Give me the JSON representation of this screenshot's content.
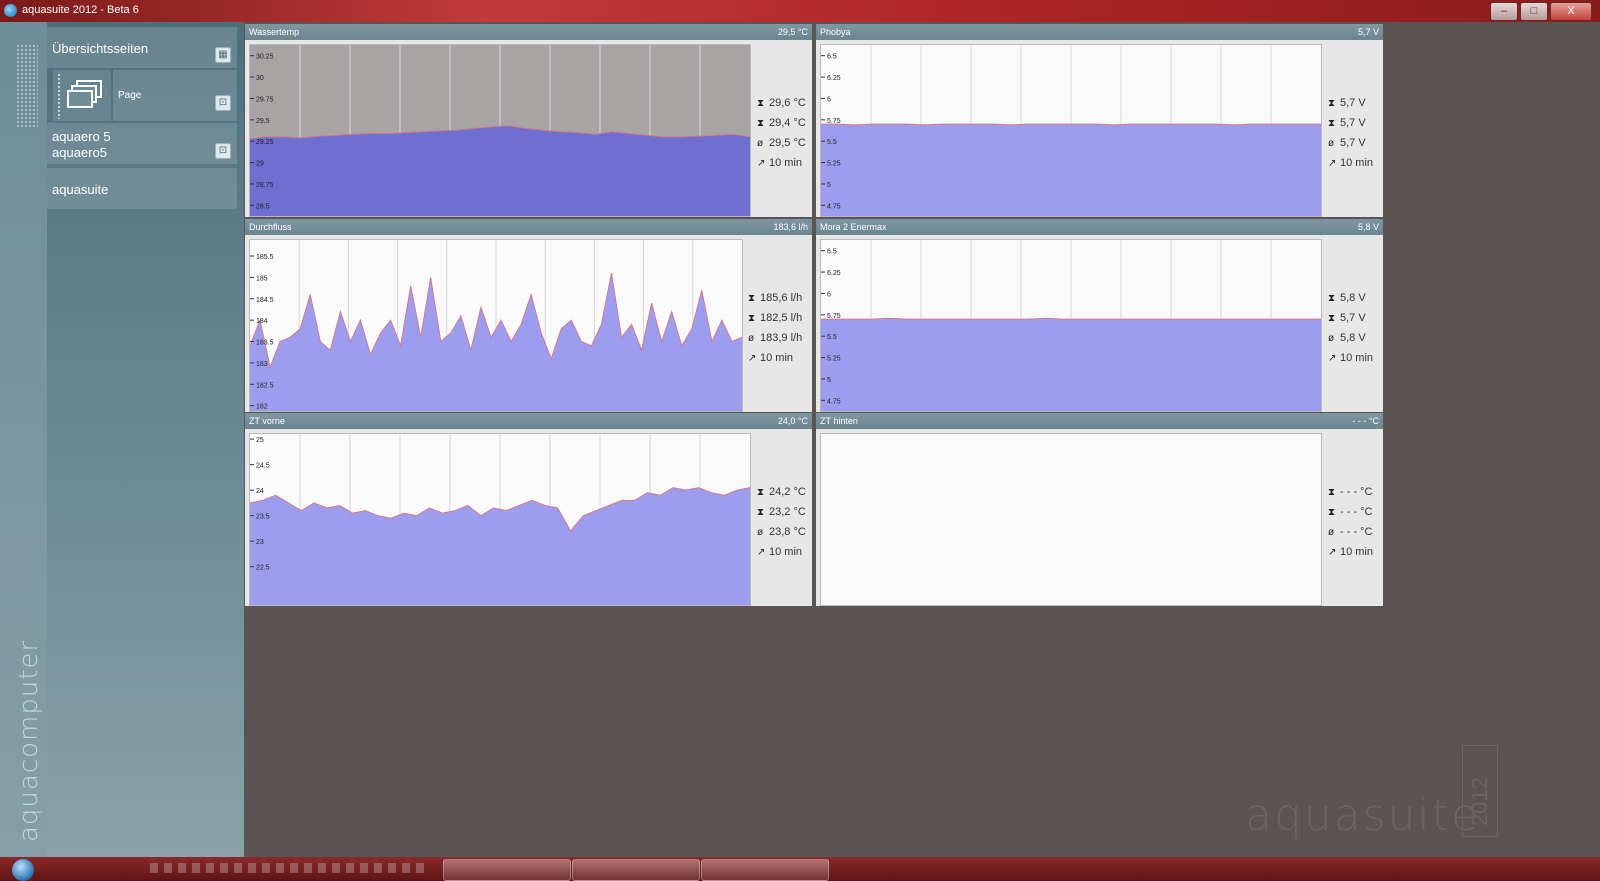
{
  "window": {
    "title": "aquasuite 2012 - Beta 6",
    "controls": {
      "minimize": "–",
      "maximize": "□",
      "close": "X"
    }
  },
  "sidebar": {
    "overview_label": "Übersichtsseiten",
    "page_label": "Page",
    "device_line1": "aquaero 5",
    "device_line2": "aquaero5",
    "aquasuite_label": "aquasuite",
    "brand_vertical": "aquacomputer"
  },
  "panels": {
    "wassertemp": {
      "name": "Wassertemp",
      "value": "29,5 °C",
      "max": "29,6 °C",
      "min": "29,4 °C",
      "avg": "29,5 °C",
      "period": "10 min"
    },
    "phobya": {
      "name": "Phobya",
      "value": "5,7 V",
      "max": "5,7 V",
      "min": "5,7 V",
      "avg": "5,7 V",
      "period": "10 min"
    },
    "durchfluss": {
      "name": "Durchfluss",
      "value": "183,6 l/h",
      "max": "185,6 l/h",
      "min": "182,5 l/h",
      "avg": "183,9 l/h",
      "period": "10 min"
    },
    "mora": {
      "name": "Mora 2 Enermax",
      "value": "5,8 V",
      "max": "5,8 V",
      "min": "5,7 V",
      "avg": "5,8 V",
      "period": "10 min"
    },
    "zt_vorne": {
      "name": "ZT vorne",
      "value": "24,0 °C",
      "max": "24,2 °C",
      "min": "23,2 °C",
      "avg": "23,8 °C",
      "period": "10 min"
    },
    "zt_hinten": {
      "name": "ZT hinten",
      "value": "- - - °C",
      "max": "- - - °C",
      "min": "- - - °C",
      "avg": "- - - °C",
      "period": "10 min"
    }
  },
  "chart_data": [
    {
      "type": "area",
      "id": "wassertemp",
      "yticks": [
        "30.25",
        "30",
        "29.75",
        "29.5",
        "29.25",
        "29",
        "28.75",
        "28.5"
      ],
      "ylim": [
        28.375,
        30.375
      ],
      "values": [
        29.28,
        29.3,
        29.3,
        29.29,
        29.31,
        29.32,
        29.33,
        29.34,
        29.34,
        29.35,
        29.36,
        29.37,
        29.38,
        29.4,
        29.42,
        29.43,
        29.4,
        29.38,
        29.36,
        29.35,
        29.33,
        29.36,
        29.34,
        29.32,
        29.3,
        29.3,
        29.31,
        29.32,
        29.33,
        29.3
      ],
      "fill": "#6b6bd4"
    },
    {
      "type": "area",
      "id": "phobya",
      "yticks": [
        "6.5",
        "6.25",
        "6",
        "5.75",
        "5.5",
        "5.25",
        "5",
        "4.75"
      ],
      "ylim": [
        4.625,
        6.625
      ],
      "values": [
        5.7,
        5.7,
        5.69,
        5.7,
        5.7,
        5.7,
        5.69,
        5.7,
        5.7,
        5.7,
        5.7,
        5.69,
        5.7,
        5.7,
        5.7,
        5.7,
        5.7,
        5.69,
        5.7,
        5.7,
        5.7,
        5.7,
        5.7,
        5.7,
        5.69,
        5.7,
        5.7,
        5.7,
        5.7,
        5.7
      ],
      "fill": "#9898ee"
    },
    {
      "type": "area",
      "id": "durchfluss",
      "yticks": [
        "185.5",
        "185",
        "184.5",
        "184",
        "183.5",
        "183",
        "182.5",
        "182"
      ],
      "ylim": [
        181.875,
        185.875
      ],
      "values": [
        183.4,
        184.0,
        182.9,
        183.5,
        183.6,
        183.8,
        184.6,
        183.5,
        183.3,
        184.2,
        183.5,
        184.0,
        183.2,
        183.7,
        184.0,
        183.4,
        184.8,
        183.6,
        185.0,
        183.5,
        183.7,
        184.1,
        183.3,
        184.3,
        183.6,
        184.0,
        183.5,
        183.9,
        184.6,
        183.7,
        183.1,
        183.8,
        184.0,
        183.5,
        183.4,
        183.9,
        185.1,
        183.6,
        183.9,
        183.3,
        184.4,
        183.5,
        184.2,
        183.4,
        183.8,
        184.7,
        183.5,
        184.0,
        183.5,
        183.6
      ],
      "fill": "#9898ee"
    },
    {
      "type": "area",
      "id": "mora",
      "yticks": [
        "6.5",
        "6.25",
        "6",
        "5.75",
        "5.5",
        "5.25",
        "5",
        "4.75"
      ],
      "ylim": [
        4.625,
        6.625
      ],
      "values": [
        5.7,
        5.7,
        5.7,
        5.7,
        5.71,
        5.7,
        5.7,
        5.7,
        5.7,
        5.7,
        5.7,
        5.7,
        5.7,
        5.71,
        5.7,
        5.7,
        5.7,
        5.7,
        5.7,
        5.7,
        5.7,
        5.7,
        5.7,
        5.7,
        5.7,
        5.7,
        5.7,
        5.7,
        5.7,
        5.7
      ],
      "fill": "#9898ee"
    },
    {
      "type": "area",
      "id": "zt_vorne",
      "yticks": [
        "25",
        "24.5",
        "24",
        "23.5",
        "23",
        "22.5"
      ],
      "ylim": [
        21.75,
        25.1
      ],
      "values": [
        23.75,
        23.8,
        23.9,
        23.75,
        23.6,
        23.75,
        23.65,
        23.7,
        23.55,
        23.6,
        23.5,
        23.45,
        23.55,
        23.5,
        23.65,
        23.55,
        23.6,
        23.7,
        23.5,
        23.65,
        23.6,
        23.7,
        23.8,
        23.7,
        23.65,
        23.2,
        23.5,
        23.6,
        23.7,
        23.8,
        23.8,
        23.95,
        23.9,
        24.05,
        24.0,
        24.05,
        23.95,
        23.9,
        24.0,
        24.05
      ],
      "fill": "#9898ee"
    }
  ],
  "watermark": {
    "text": "aquasuite",
    "year": "2012"
  }
}
